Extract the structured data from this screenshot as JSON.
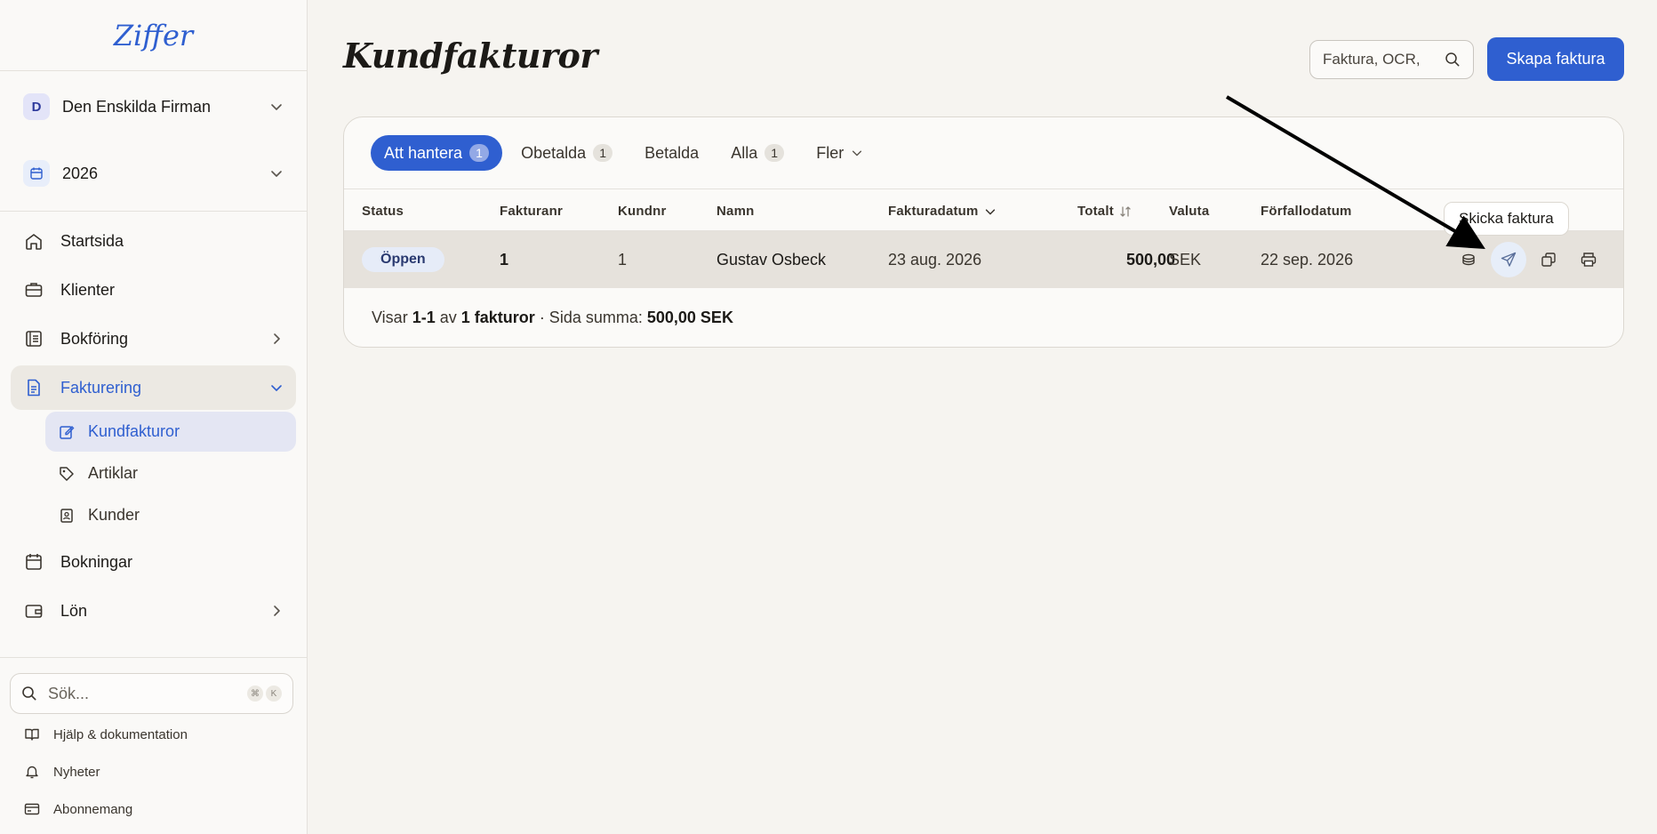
{
  "app": {
    "logo": "Ziffer"
  },
  "sidebar": {
    "company": {
      "initial": "D",
      "name": "Den Enskilda Firman"
    },
    "year": "2026",
    "nav": [
      {
        "label": "Startsida",
        "icon": "home-icon"
      },
      {
        "label": "Klienter",
        "icon": "briefcase-icon"
      },
      {
        "label": "Bokföring",
        "icon": "ledger-icon"
      },
      {
        "label": "Fakturering",
        "icon": "document-icon"
      },
      {
        "label": "Bokningar",
        "icon": "calendar-icon"
      },
      {
        "label": "Lön",
        "icon": "wallet-icon"
      }
    ],
    "sub_nav": [
      {
        "label": "Kundfakturor",
        "icon": "edit-icon"
      },
      {
        "label": "Artiklar",
        "icon": "tag-icon"
      },
      {
        "label": "Kunder",
        "icon": "contact-icon"
      }
    ],
    "search": {
      "placeholder": "Sök...",
      "kbd1": "⌘",
      "kbd2": "K"
    },
    "footer": [
      {
        "label": "Hjälp & dokumentation",
        "icon": "book-icon"
      },
      {
        "label": "Nyheter",
        "icon": "bell-icon"
      },
      {
        "label": "Abonnemang",
        "icon": "card-icon"
      }
    ]
  },
  "main": {
    "title": "Kundfakturor",
    "search_placeholder": "Faktura, OCR,",
    "create_button": "Skapa faktura",
    "tabs": [
      {
        "label": "Att hantera",
        "count": "1"
      },
      {
        "label": "Obetalda",
        "count": "1"
      },
      {
        "label": "Betalda"
      },
      {
        "label": "Alla",
        "count": "1"
      },
      {
        "label": "Fler"
      }
    ],
    "columns": {
      "status": "Status",
      "fakturanr": "Fakturanr",
      "kundnr": "Kundnr",
      "namn": "Namn",
      "fakturadatum": "Fakturadatum",
      "totalt": "Totalt",
      "valuta": "Valuta",
      "forfallodatum": "Förfallodatum"
    },
    "rows": [
      {
        "status": "Öppen",
        "fakturanr": "1",
        "kundnr": "1",
        "namn": "Gustav Osbeck",
        "fakturadatum": "23 aug. 2026",
        "totalt": "500,00",
        "valuta": "SEK",
        "forfallodatum": "22 sep. 2026"
      }
    ],
    "footer": {
      "prefix": "Visar",
      "range": "1-1",
      "of": "av",
      "total": "1 fakturor",
      "sum_label": "· Sida summa:",
      "sum_value": "500,00 SEK"
    },
    "tooltip": "Skicka faktura"
  },
  "colors": {
    "accent": "#2f5fd0",
    "background": "#f6f4f0",
    "sidebar": "#faf9f7",
    "row_highlight": "#e6e2dc"
  }
}
